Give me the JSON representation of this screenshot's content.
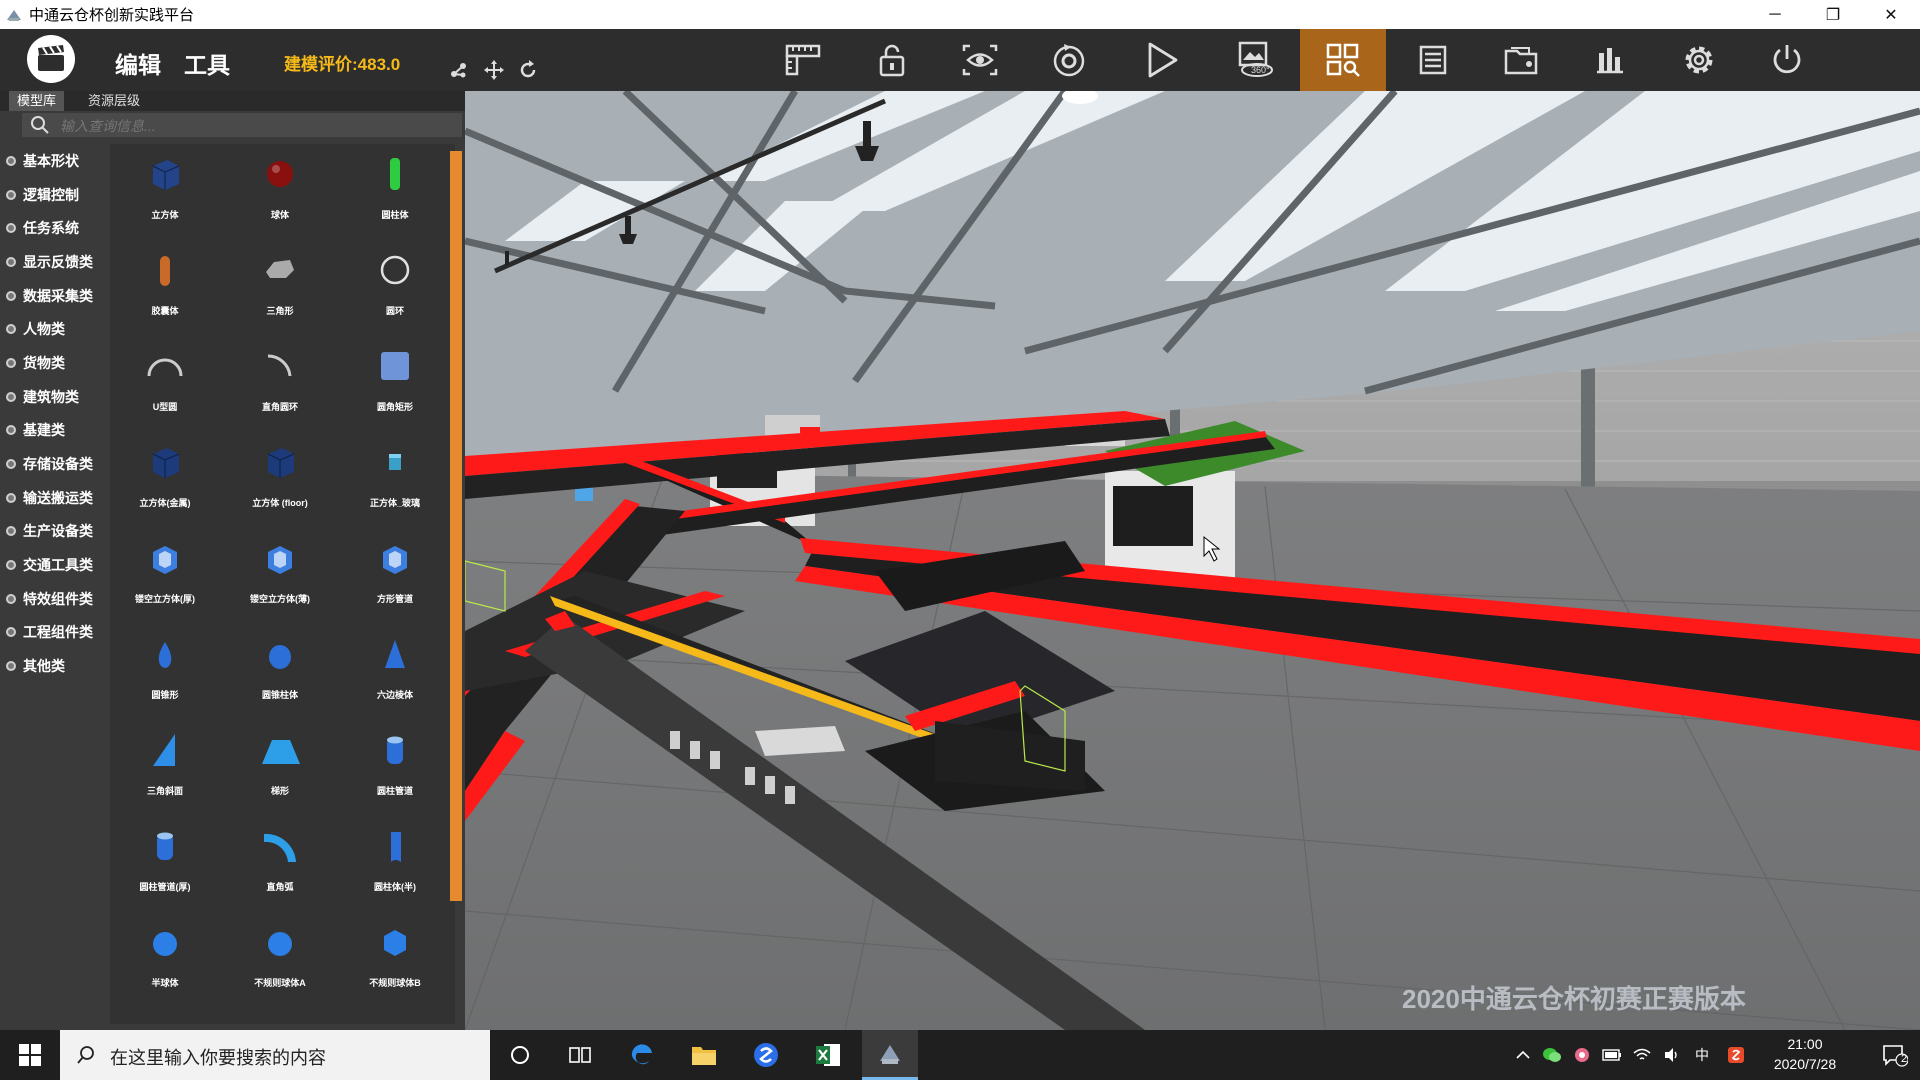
{
  "window": {
    "title": "中通云仓杯创新实践平台",
    "minimize": "─",
    "restore": "❐",
    "close": "✕"
  },
  "toolbar": {
    "menu": [
      "编辑",
      "工具"
    ],
    "score_label": "建模评价:483.0",
    "small_tools": [
      "move-node-icon",
      "move-arrows-icon",
      "rotate-icon"
    ],
    "buttons": [
      {
        "name": "ruler-icon"
      },
      {
        "name": "lock-icon"
      },
      {
        "name": "eye-view-icon"
      },
      {
        "name": "reset-icon"
      },
      {
        "name": "play-icon"
      },
      {
        "name": "view-360-icon",
        "badge": "360°"
      },
      {
        "name": "grid-search-icon",
        "active": true
      },
      {
        "name": "list-icon"
      },
      {
        "name": "folder-open-icon"
      },
      {
        "name": "bar-chart-icon"
      },
      {
        "name": "settings-icon"
      },
      {
        "name": "power-icon"
      }
    ]
  },
  "sidebar": {
    "tabs": [
      "模型库",
      "资源层级"
    ],
    "search_placeholder": "输入查询信息...",
    "categories": [
      "基本形状",
      "逻辑控制",
      "任务系统",
      "显示反馈类",
      "数据采集类",
      "人物类",
      "货物类",
      "建筑物类",
      "基建类",
      "存储设备类",
      "输送搬运类",
      "生产设备类",
      "交通工具类",
      "特效组件类",
      "工程组件类",
      "其他类"
    ],
    "models": [
      {
        "label": "立方体",
        "shape": "cube",
        "color": "#24448a"
      },
      {
        "label": "球体",
        "shape": "sphere",
        "color": "#8a1010"
      },
      {
        "label": "圆柱体",
        "shape": "cylinder",
        "color": "#2ecc40"
      },
      {
        "label": "胶囊体",
        "shape": "capsule",
        "color": "#c86a2a"
      },
      {
        "label": "三角形",
        "shape": "hexplate",
        "color": "#aaaaaa"
      },
      {
        "label": "圆环",
        "shape": "ring",
        "color": "#e0e0e0"
      },
      {
        "label": "U型圆",
        "shape": "arc",
        "color": "#cccccc"
      },
      {
        "label": "直角圆环",
        "shape": "quarter",
        "color": "#cccccc"
      },
      {
        "label": "圆角矩形",
        "shape": "roundrect",
        "color": "#6f95d8"
      },
      {
        "label": "立方体(金属)",
        "shape": "cube",
        "color": "#1d3a7a"
      },
      {
        "label": "立方体 (floor)",
        "shape": "cube",
        "color": "#1d3a7a"
      },
      {
        "label": "正方体_玻璃",
        "shape": "smallcube",
        "color": "#3aa0c8"
      },
      {
        "label": "镂空立方体(厚)",
        "shape": "hollowcube",
        "color": "#3d7fe0"
      },
      {
        "label": "镂空立方体(薄)",
        "shape": "hollowcube",
        "color": "#3d7fe0"
      },
      {
        "label": "方形管道",
        "shape": "hollowcube",
        "color": "#3d7fe0"
      },
      {
        "label": "圆锥形",
        "shape": "drop",
        "color": "#2d6fd8"
      },
      {
        "label": "圆锥柱体",
        "shape": "egg",
        "color": "#2d6fd8"
      },
      {
        "label": "六边棱体",
        "shape": "cone",
        "color": "#2d6fd8"
      },
      {
        "label": "三角斜面",
        "shape": "wedge",
        "color": "#2d8fe8"
      },
      {
        "label": "梯形",
        "shape": "trapezoid",
        "color": "#2d9fe8"
      },
      {
        "label": "圆柱管道",
        "shape": "tube",
        "color": "#2d6fd8"
      },
      {
        "label": "圆柱管道(厚)",
        "shape": "tube",
        "color": "#2d6fd8"
      },
      {
        "label": "直角弧",
        "shape": "curve",
        "color": "#2d9fe8"
      },
      {
        "label": "圆柱体(半)",
        "shape": "halfcyl",
        "color": "#2d6fd8"
      },
      {
        "label": "半球体",
        "shape": "sphere2",
        "color": "#2d7fe8"
      },
      {
        "label": "不规则球体A",
        "shape": "sphere2",
        "color": "#2d7fe8"
      },
      {
        "label": "不规则球体B",
        "shape": "hex",
        "color": "#2d7fe8"
      }
    ]
  },
  "viewport": {
    "watermark": "2020中通云仓杯初赛正赛版本"
  },
  "taskbar": {
    "search_placeholder": "在这里输入你要搜索的内容",
    "apps": [
      "cortana-icon",
      "task-view-icon",
      "edge-icon",
      "file-explorer-icon",
      "sogou-icon",
      "excel-icon",
      "platform-app-icon"
    ],
    "tray": [
      "chevron-up-icon",
      "wechat-icon",
      "app-tray-icon",
      "battery-icon",
      "network-icon",
      "volume-icon",
      "中",
      "sogou-tray-icon"
    ],
    "time": "21:00",
    "date": "2020/7/28",
    "notification_count": "2"
  },
  "colors": {
    "accent_active": "#a9651a",
    "score": "#f6b91a",
    "conveyor_red": "#ff1a1a"
  }
}
